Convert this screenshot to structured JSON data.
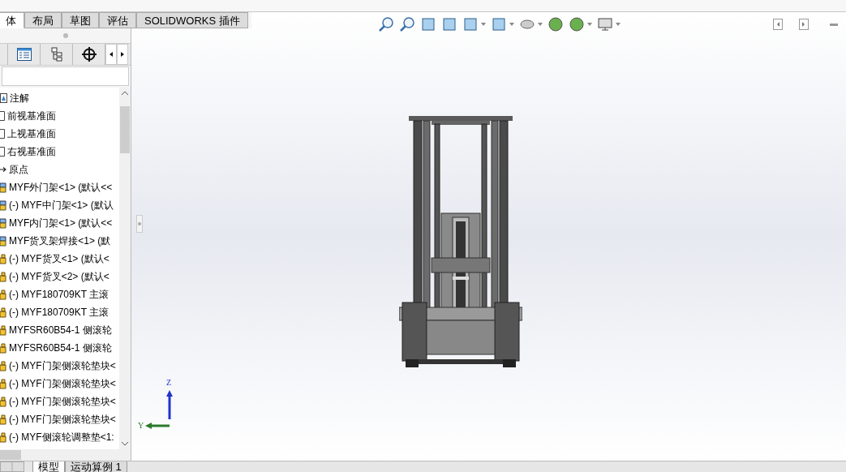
{
  "command_tabs": [
    {
      "label": "体",
      "selected": true
    },
    {
      "label": "布局",
      "selected": false
    },
    {
      "label": "草图",
      "selected": false
    },
    {
      "label": "评估",
      "selected": false
    },
    {
      "label": "SOLIDWORKS 插件",
      "selected": false
    }
  ],
  "tree": [
    {
      "kind": "annotation",
      "label": "注解"
    },
    {
      "kind": "plane",
      "label": "前视基准面"
    },
    {
      "kind": "plane",
      "label": "上视基准面"
    },
    {
      "kind": "plane",
      "label": "右视基准面"
    },
    {
      "kind": "origin",
      "label": "原点"
    },
    {
      "kind": "assembly",
      "label": "MYF外门架<1> (默认<<"
    },
    {
      "kind": "assembly",
      "label": "(-) MYF中门架<1> (默认"
    },
    {
      "kind": "assembly",
      "label": "MYF内门架<1> (默认<<"
    },
    {
      "kind": "assembly",
      "label": "MYF货叉架焊接<1> (默"
    },
    {
      "kind": "part",
      "label": "(-) MYF货叉<1> (默认<"
    },
    {
      "kind": "part",
      "label": "(-) MYF货叉<2> (默认<"
    },
    {
      "kind": "part",
      "label": "(-) MYF180709KT 主滚"
    },
    {
      "kind": "part",
      "label": "(-) MYF180709KT 主滚"
    },
    {
      "kind": "part",
      "label": "MYFSR60B54-1 侧滚轮"
    },
    {
      "kind": "part",
      "label": "MYFSR60B54-1 侧滚轮"
    },
    {
      "kind": "part",
      "label": "(-) MYF门架侧滚轮垫块<"
    },
    {
      "kind": "part",
      "label": "(-) MYF门架侧滚轮垫块<"
    },
    {
      "kind": "part",
      "label": "(-) MYF门架侧滚轮垫块<"
    },
    {
      "kind": "part",
      "label": "(-) MYF门架侧滚轮垫块<"
    },
    {
      "kind": "part",
      "label": "(-) MYF侧滚轮调整垫<1:"
    }
  ],
  "triad": {
    "z": "Z",
    "y": "Y"
  },
  "bottom_tabs": [
    {
      "label": "模型",
      "selected": true
    },
    {
      "label": "运动算例 1",
      "selected": false
    }
  ]
}
